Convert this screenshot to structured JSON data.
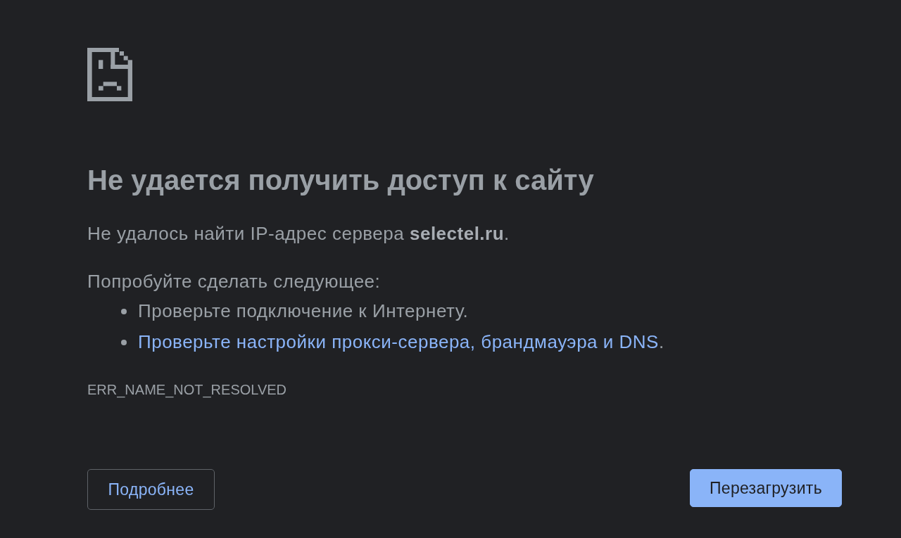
{
  "heading": "Не удается получить доступ к сайту",
  "message": "Не удалось найти IP-адрес сервера **selectel.ru**.",
  "suggestions_title": "Попробуйте сделать следующее:",
  "suggestions": [
    {
      "kind": "text",
      "text": "Проверьте подключение к Интернету."
    },
    {
      "kind": "link",
      "text": "Проверьте настройки прокси-сервера, брандмауэра и DNS",
      "after": "."
    }
  ],
  "error_code": "ERR_NAME_NOT_RESOLVED",
  "buttons": [
    {
      "kind": "secondary",
      "label": "Подробнее"
    },
    {
      "kind": "primary",
      "label": "Перезагрузить"
    }
  ]
}
